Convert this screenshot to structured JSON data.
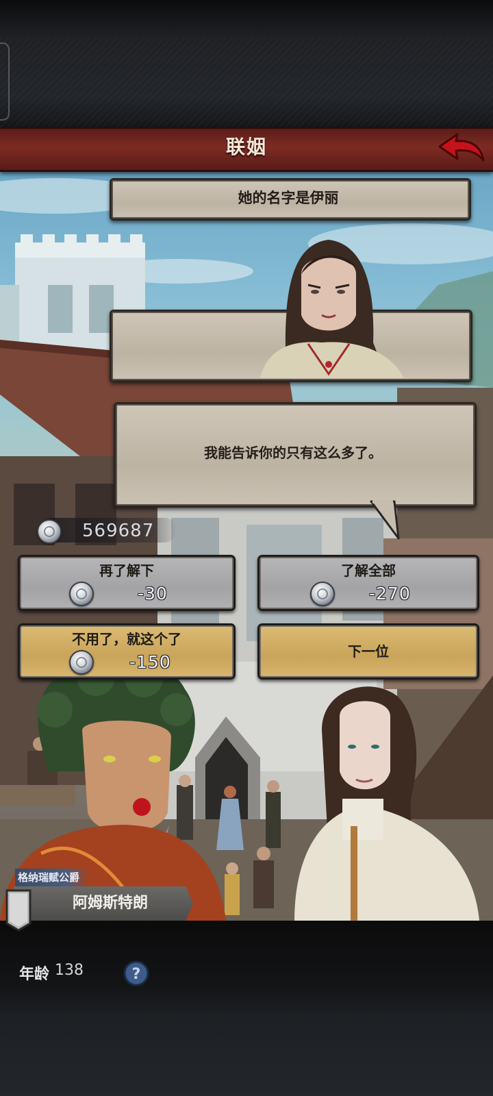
{
  "header": {
    "title": "联姻"
  },
  "candidate": {
    "name_line": "她的名字是伊丽",
    "speech": "我能告诉你的只有这么多了。"
  },
  "player": {
    "money": "569687"
  },
  "actions": {
    "learn_more": {
      "label": "再了解下",
      "cost": "-30"
    },
    "learn_all": {
      "label": "了解全部",
      "cost": "-270"
    },
    "accept": {
      "label": "不用了，就这个了",
      "cost": "-150"
    },
    "next": {
      "label": "下一位"
    }
  },
  "suitor": {
    "rank": "格纳瑞赋公爵",
    "name": "阿姆斯特朗",
    "age_label": "年龄",
    "age": "138"
  },
  "icons": {
    "back": "back-arrow-icon",
    "coin": "silver-coin-icon",
    "help": "question-mark-icon",
    "banner": "heraldic-banner-icon"
  },
  "colors": {
    "title_bar": "#7d2b23",
    "button_grey": "#a3a3a6",
    "button_gold": "#c9a45a",
    "rank_tag": "#4c5c7c"
  }
}
